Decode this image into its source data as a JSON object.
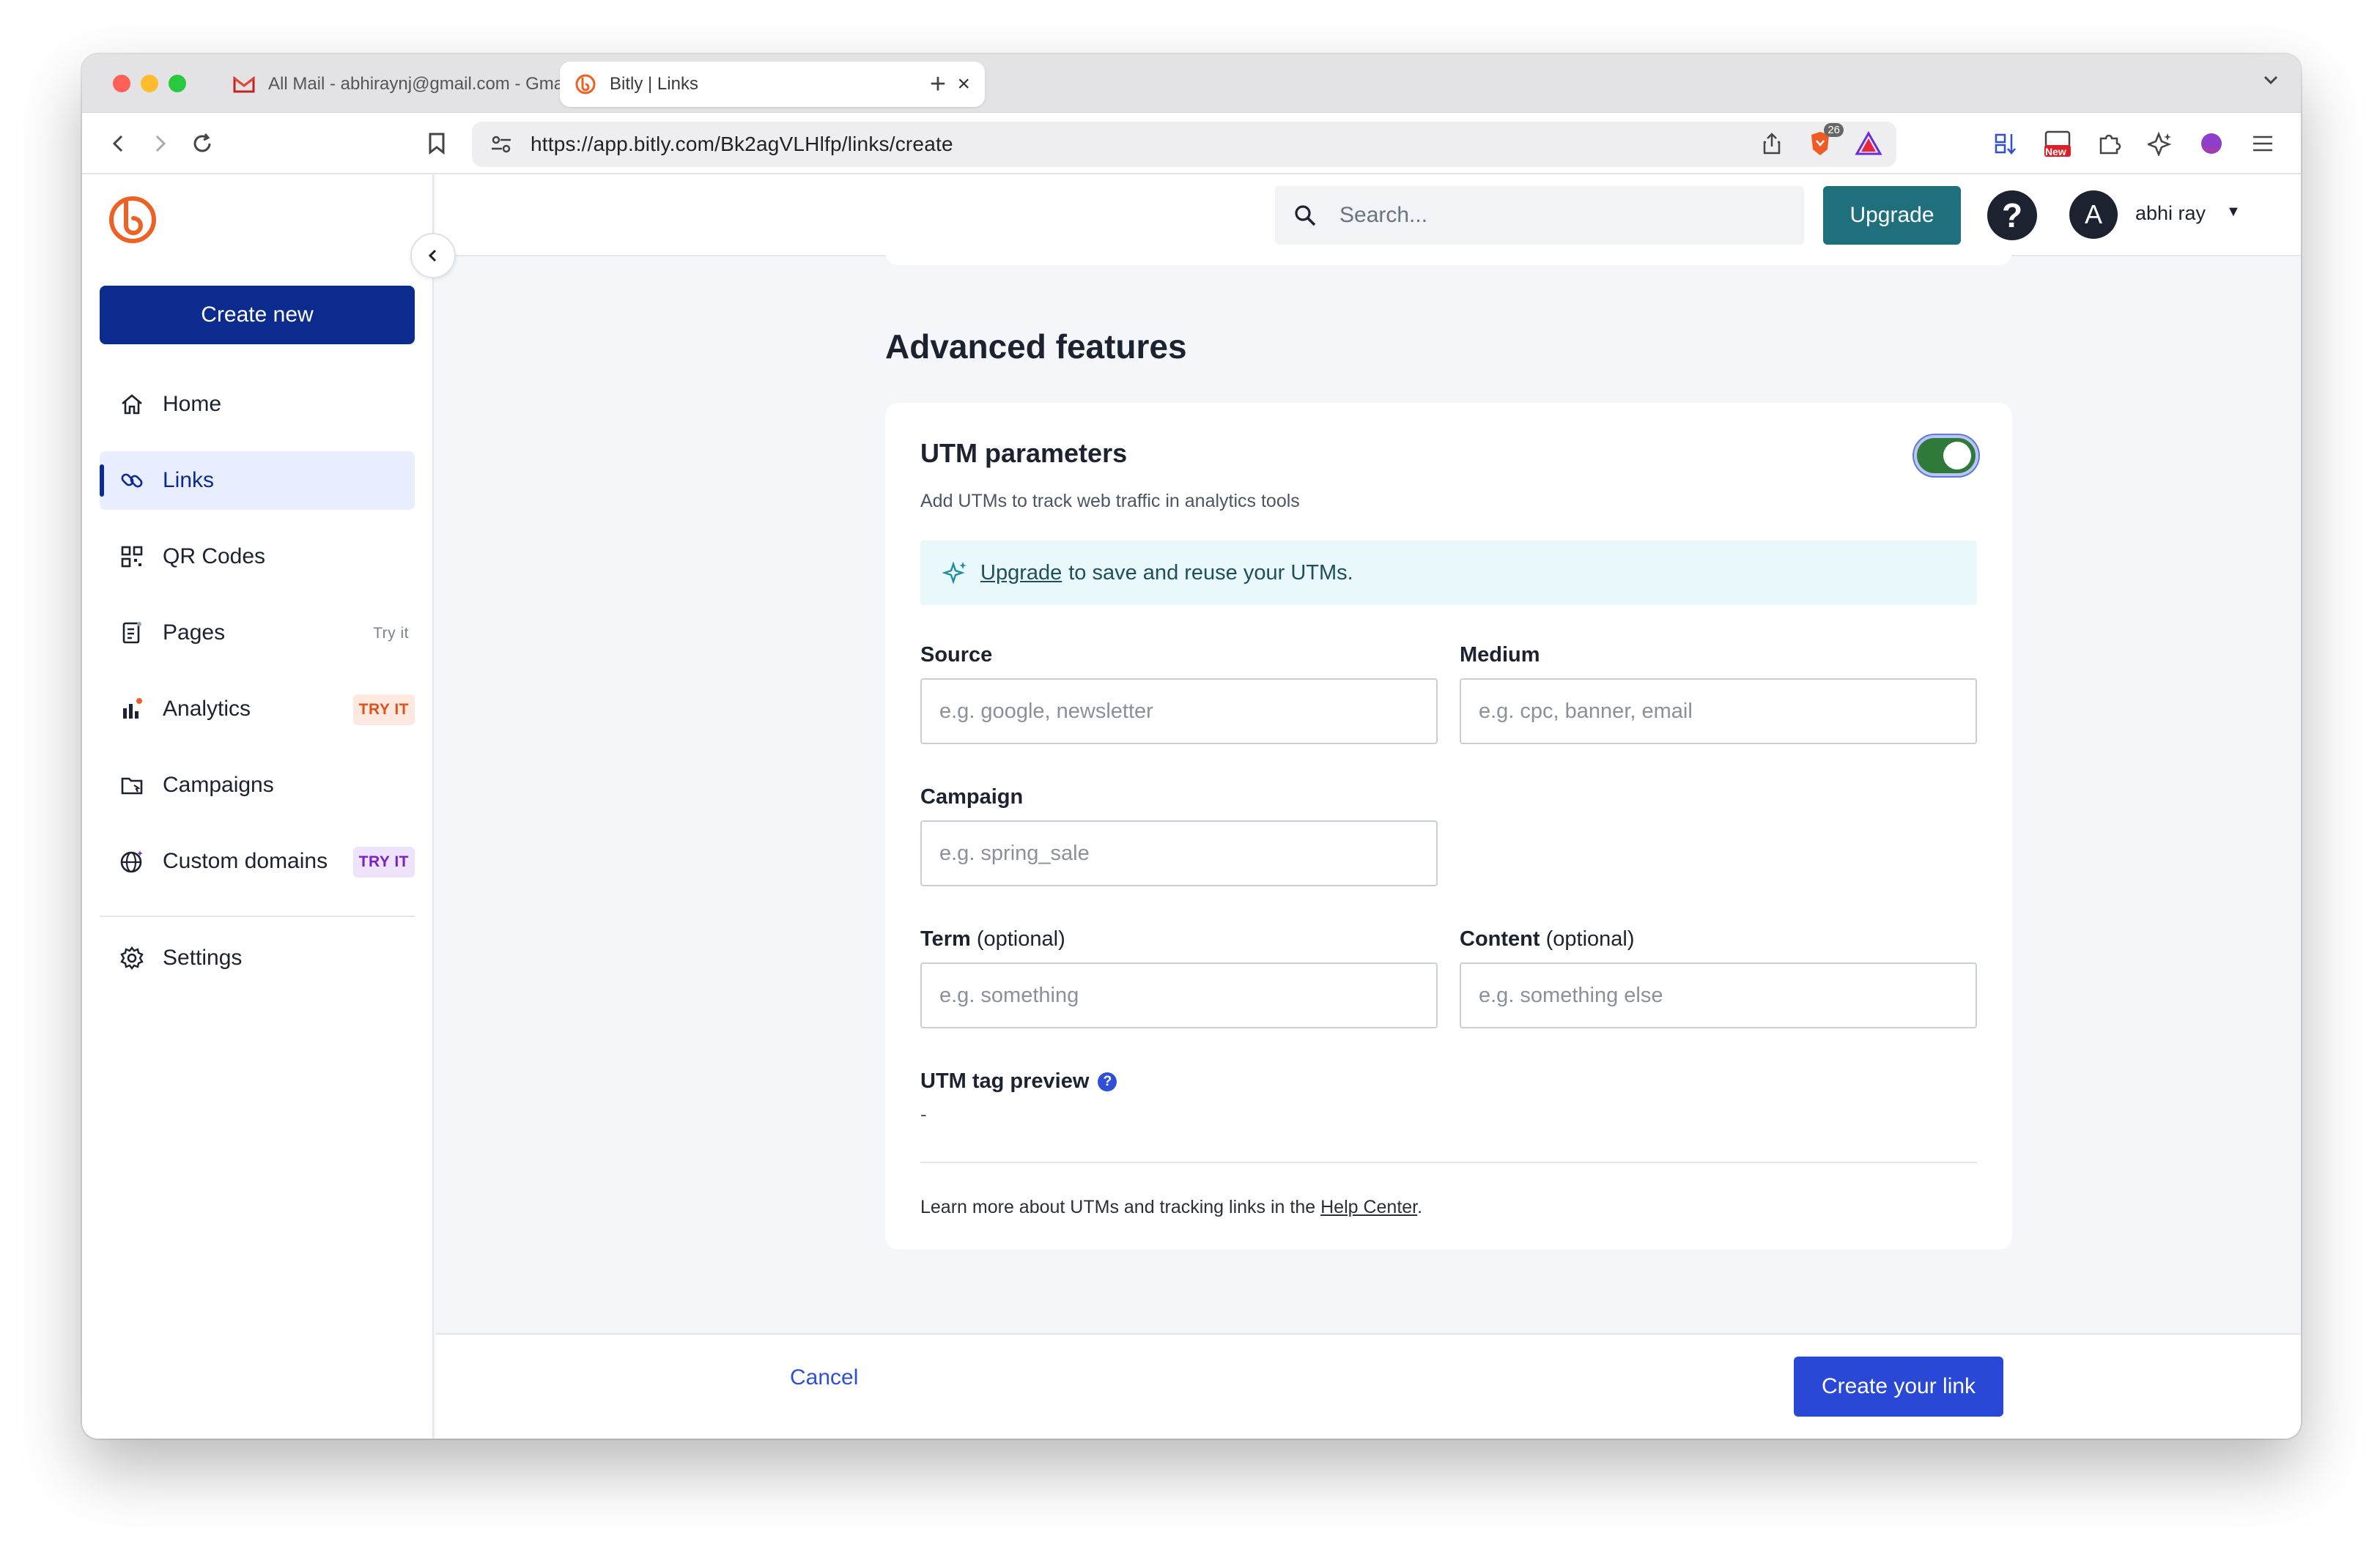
{
  "browser": {
    "tabs": [
      {
        "title": "All Mail - abhiraynj@gmail.com - Gmail",
        "active": false
      },
      {
        "title": "Bitly | Links",
        "active": true
      }
    ],
    "url": "https://app.bitly.com/Bk2agVLHlfp/links/create",
    "brave_badge_count": "26",
    "new_badge": "New"
  },
  "sidebar": {
    "create_new_label": "Create new",
    "items": [
      {
        "label": "Home",
        "icon": "home-icon",
        "badge": ""
      },
      {
        "label": "Links",
        "icon": "link-icon",
        "badge": "",
        "active": true
      },
      {
        "label": "QR Codes",
        "icon": "qr-code-icon",
        "badge": ""
      },
      {
        "label": "Pages",
        "icon": "pages-icon",
        "badge": "Try it"
      },
      {
        "label": "Analytics",
        "icon": "analytics-icon",
        "badge": "TRY IT"
      },
      {
        "label": "Campaigns",
        "icon": "campaigns-icon",
        "badge": ""
      },
      {
        "label": "Custom domains",
        "icon": "globe-icon",
        "badge": "TRY IT"
      },
      {
        "label": "Settings",
        "icon": "gear-icon",
        "badge": ""
      }
    ]
  },
  "header": {
    "search_placeholder": "Search...",
    "upgrade_label": "Upgrade",
    "help_label": "?",
    "avatar_initial": "A",
    "user_name": "abhi ray"
  },
  "main": {
    "section_title": "Advanced features",
    "utm": {
      "title": "UTM parameters",
      "subtitle": "Add UTMs to track web traffic in analytics tools",
      "enabled": true,
      "banner_link": "Upgrade",
      "banner_text": "to save and reuse your UTMs.",
      "source_label": "Source",
      "source_placeholder": "e.g. google, newsletter",
      "medium_label": "Medium",
      "medium_placeholder": "e.g. cpc, banner, email",
      "campaign_label": "Campaign",
      "campaign_placeholder": "e.g. spring_sale",
      "term_label": "Term",
      "term_optional": "(optional)",
      "term_placeholder": "e.g. something",
      "content_label": "Content",
      "content_optional": "(optional)",
      "content_placeholder": "e.g. something else",
      "preview_label": "UTM tag preview",
      "preview_value": "-",
      "learn_more_text": "Learn more about UTMs and tracking links in the",
      "help_center_link": "Help Center",
      "learn_more_end": "."
    }
  },
  "footer": {
    "cancel_label": "Cancel",
    "create_label": "Create your link"
  },
  "colors": {
    "brand_navy": "#0b2b8f",
    "upgrade_teal": "#1f6f7d",
    "toggle_green": "#2f7a3b",
    "primary_blue": "#2a48d6",
    "bitly_orange": "#ee6123"
  }
}
